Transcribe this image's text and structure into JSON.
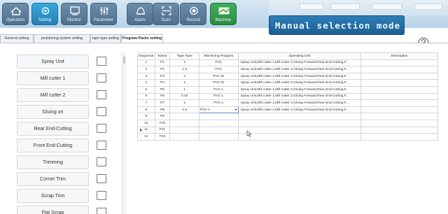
{
  "toolbar": {
    "buttons": [
      {
        "label": "Operation",
        "icon": "home-icon"
      },
      {
        "label": "Setting",
        "icon": "gear-icon"
      },
      {
        "label": "Monitor",
        "icon": "monitor-icon"
      },
      {
        "label": "Parameter",
        "icon": "sliders-icon"
      },
      {
        "label": "Alarm",
        "icon": "alarm-icon"
      },
      {
        "label": "Scan",
        "icon": "scan-icon"
      },
      {
        "label": "Record",
        "icon": "record-icon"
      },
      {
        "label": "Machine",
        "icon": "machine-icon"
      }
    ]
  },
  "mode_banner": "Manual selection mode",
  "tabs": [
    "General setting",
    "positioning system setting",
    "tape type setting",
    "Program Packs setting"
  ],
  "options": [
    "Spray Unit",
    "Mill cutter 1",
    "Mill cutter 2",
    "Gluing on",
    "Rear End-Cutting",
    "Front End-Cutting",
    "Trimming",
    "Corner Trim",
    "Scrap Trim",
    "Flat Scrap"
  ],
  "grid": {
    "headers": [
      "Sequence",
      "Name",
      "Tape Type",
      "Machining Program",
      "Operating Unit",
      "Description"
    ],
    "rows": [
      [
        "1",
        "P1",
        "1",
        "PVC",
        "Spray Unit,Mill cutter 1,Mill cutter 2,Gluing Forward,Rear End-Cutting,F...",
        ""
      ],
      [
        "2",
        "P2",
        "1.5",
        "PVC",
        "Spray Unit,Mill cutter 1,Mill cutter 2,Gluing Forward,Rear End-Cutting,F...",
        ""
      ],
      [
        "3",
        "P3",
        "2",
        "PVC-W",
        "Spray Unit,Mill cutter 1,Mill cutter 2,Gluing Forward,Rear End-Cutting,F...",
        ""
      ],
      [
        "4",
        "P4",
        "1",
        "PVC-W",
        "Spray Unit,Mill cutter 1,Mill cutter 2,Gluing Forward,Rear End-Cutting,F...",
        ""
      ],
      [
        "5",
        "P5",
        "1",
        "PVC-L",
        "Spray Unit,Mill cutter 1,Mill cutter 2,Gluing Forward,Rear End-Cutting,F...",
        ""
      ],
      [
        "6",
        "P6",
        "0.45",
        "PVC-L",
        "Spray Unit,Mill cutter 1,Mill cutter 2,Gluing Forward,Rear End-Cutting,F...",
        ""
      ],
      [
        "7",
        "P7",
        "2",
        "PVC-L",
        "Spray Unit,Mill cutter 1,Mill cutter 2,Gluing Forward,Rear End-Cutting,F...",
        ""
      ],
      [
        "8",
        "P8",
        "0.8",
        "PVC-L",
        "Spray Unit,Mill cutter 1,Mill cutter 2,Gluing Forward,Rear End-Cutting,F...",
        ""
      ],
      [
        "9",
        "P9",
        "",
        "",
        "",
        ""
      ],
      [
        "10",
        "P10",
        "",
        "",
        "",
        ""
      ],
      [
        "11",
        "P11",
        "",
        "",
        "",
        ""
      ],
      [
        "12",
        "P12",
        "",
        "",
        "",
        ""
      ]
    ],
    "selected_row_index": 7
  }
}
